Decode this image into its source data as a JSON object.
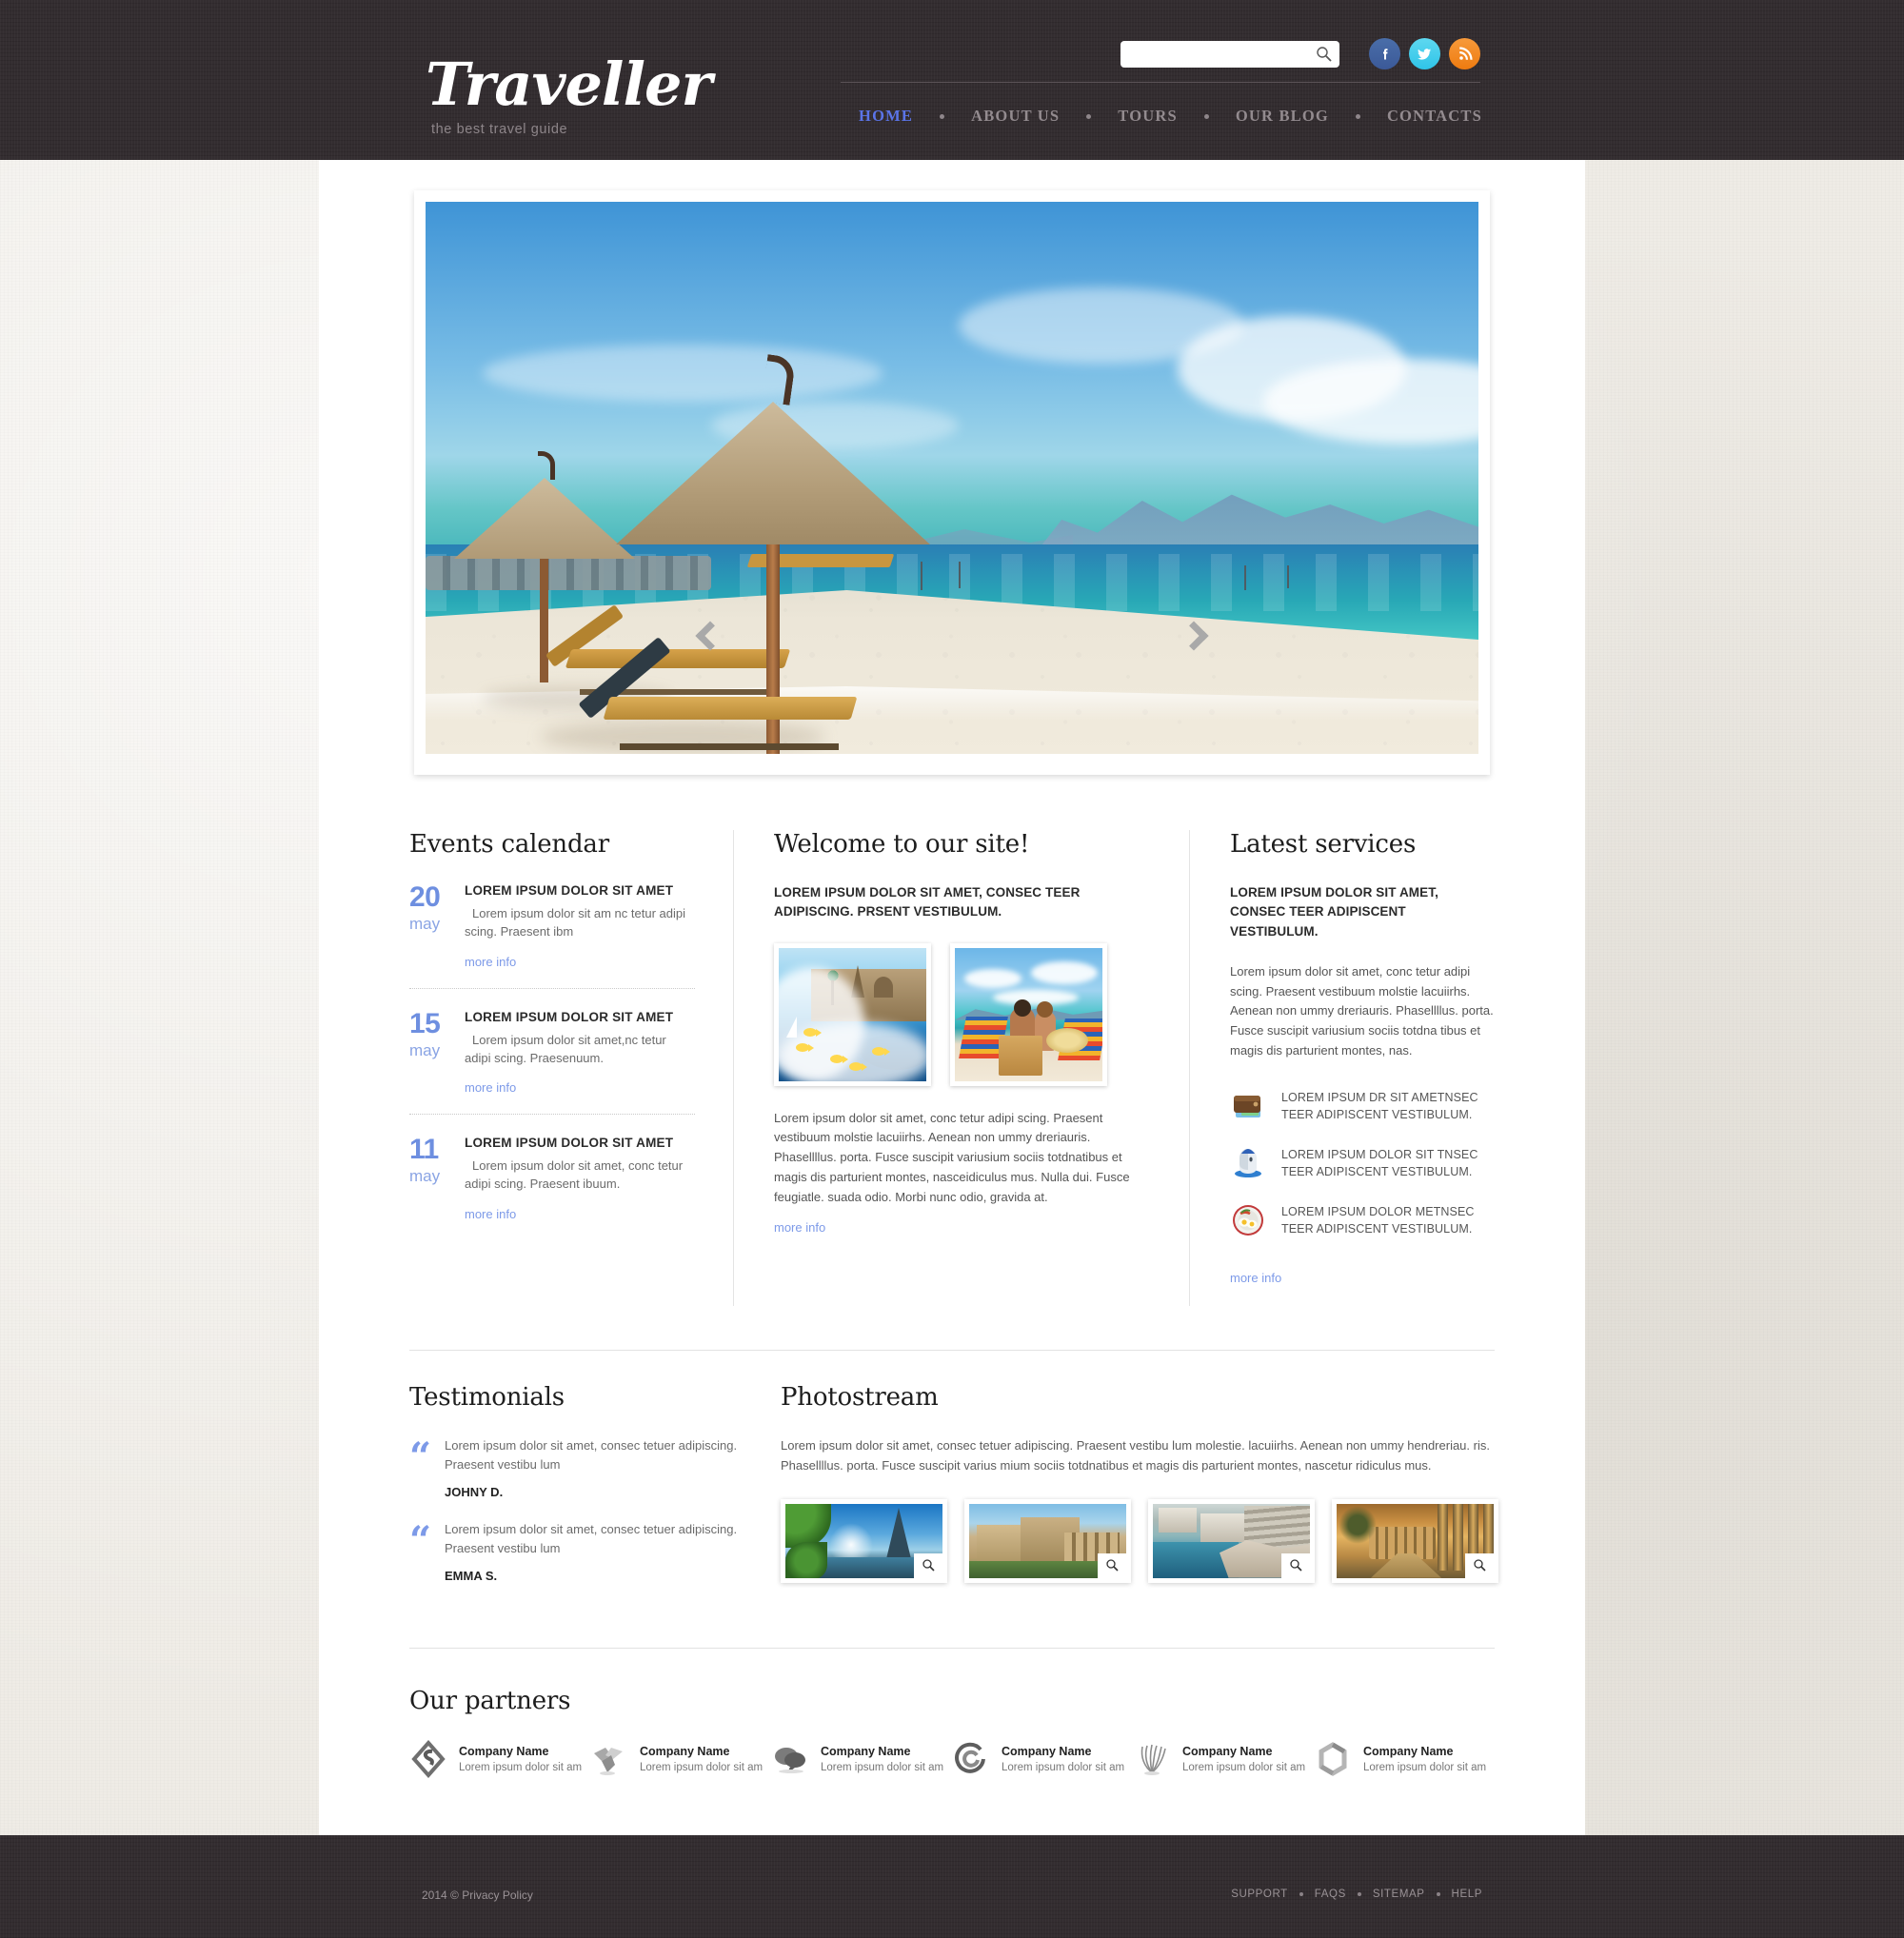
{
  "header": {
    "logo": "Traveller",
    "tagline": "the best travel guide",
    "search": {
      "placeholder": "",
      "value": "",
      "icon": "search-icon"
    },
    "social": [
      {
        "name": "facebook-icon",
        "color": "#3b5998"
      },
      {
        "name": "twitter-icon",
        "color": "#2fc4e8"
      },
      {
        "name": "rss-icon",
        "color": "#ee7b10"
      }
    ],
    "nav": [
      {
        "label": "HOME",
        "active": true
      },
      {
        "label": "ABOUT US",
        "active": false
      },
      {
        "label": "TOURS",
        "active": false
      },
      {
        "label": "OUR BLOG",
        "active": false
      },
      {
        "label": "CONTACTS",
        "active": false
      }
    ]
  },
  "slider": {
    "prev_label": "‹",
    "next_label": "›",
    "image_alt": "beach-with-thatched-parasols"
  },
  "events": {
    "title": "Events calendar",
    "items": [
      {
        "day": "20",
        "month": "may",
        "title": "LOREM IPSUM DOLOR SIT AMET",
        "desc": "Lorem ipsum dolor sit am nc tetur adipi scing. Praesent ibm",
        "more": "more info"
      },
      {
        "day": "15",
        "month": "may",
        "title": "LOREM IPSUM DOLOR SIT AMET",
        "desc": "Lorem ipsum dolor sit amet,nc tetur adipi scing. Praesenuum.",
        "more": "more info"
      },
      {
        "day": "11",
        "month": "may",
        "title": "LOREM IPSUM DOLOR SIT AMET",
        "desc": "Lorem ipsum dolor sit amet, conc tetur adipi scing. Praesent ibuum.",
        "more": "more info"
      }
    ]
  },
  "welcome": {
    "title": "Welcome to our site!",
    "lead": "LOREM IPSUM DOLOR SIT AMET, CONSEC TEER ADIPISCING. PRSENT VESTIBULUM.",
    "images": [
      {
        "name": "travel-collage-image"
      },
      {
        "name": "beach-couple-image"
      }
    ],
    "body": "Lorem ipsum dolor sit amet, conc tetur adipi scing. Praesent vestibuum molstie lacuiirhs. Aenean non ummy dreriauris. Phasellllus. porta. Fusce suscipit variusium sociis totdnatibus et magis dis parturient montes, nasceidiculus mus. Nulla dui. Fusce feugiatle. suada odio. Morbi nunc odio, gravida at.",
    "more": "more info"
  },
  "services": {
    "title": "Latest services",
    "lead": "LOREM IPSUM DOLOR SIT AMET, CONSEC TEER ADIPISCENT VESTIBULUM.",
    "body": "Lorem ipsum dolor sit amet, conc tetur adipi scing. Praesent vestibuum molstie lacuiirhs. Aenean non ummy dreriauris. Phasellllus. porta. Fusce suscipit variusium sociis totdna tibus et magis dis parturient montes, nas.",
    "items": [
      {
        "icon": "wallet-icon",
        "text": "LOREM IPSUM DR SIT AMETNSEC TEER ADIPISCENT VESTIBULUM."
      },
      {
        "icon": "mouse-icon",
        "text": "LOREM IPSUM DOLOR SIT TNSEC TEER ADIPISCENT VESTIBULUM."
      },
      {
        "icon": "breakfast-plate-icon",
        "text": "LOREM IPSUM DOLOR METNSEC TEER ADIPISCENT VESTIBULUM."
      }
    ],
    "more": "more info"
  },
  "testimonials": {
    "title": "Testimonials",
    "items": [
      {
        "quote": "“",
        "text": "Lorem ipsum dolor sit amet, consec tetuer adipiscing. Praesent vestibu lum",
        "author": "JOHNY D."
      },
      {
        "quote": "“",
        "text": "Lorem ipsum dolor sit amet, consec tetuer adipiscing. Praesent vestibu lum",
        "author": "EMMA S."
      }
    ]
  },
  "photostream": {
    "title": "Photostream",
    "intro": "Lorem ipsum dolor sit amet, consec tetuer adipiscing. Praesent vestibu lum molestie. lacuiirhs. Aenean non ummy hendreriau. ris. Phasellllus. porta. Fusce suscipit varius mium sociis totdnatibus et magis dis parturient montes, nascetur ridiculus mus.",
    "items": [
      {
        "name": "eiffel-tower-photo",
        "zoom": "zoom-icon"
      },
      {
        "name": "roman-ruins-photo",
        "zoom": "zoom-icon"
      },
      {
        "name": "coastal-resort-photo",
        "zoom": "zoom-icon"
      },
      {
        "name": "colosseum-photo",
        "zoom": "zoom-icon"
      }
    ]
  },
  "partners": {
    "title": "Our partners",
    "items": [
      {
        "logo": "diamond-s-logo",
        "name": "Company Name",
        "desc": "Lorem ipsum dolor sit am"
      },
      {
        "logo": "folded-ribbon-logo",
        "name": "Company Name",
        "desc": "Lorem ipsum dolor sit am"
      },
      {
        "logo": "speech-bubbles-logo",
        "name": "Company Name",
        "desc": "Lorem ipsum dolor sit am"
      },
      {
        "logo": "circle-spiral-logo",
        "name": "Company Name",
        "desc": "Lorem ipsum dolor sit am"
      },
      {
        "logo": "feather-fan-logo",
        "name": "Company Name",
        "desc": "Lorem ipsum dolor sit am"
      },
      {
        "logo": "hexagon-ring-logo",
        "name": "Company Name",
        "desc": "Lorem ipsum dolor sit am"
      }
    ]
  },
  "footer": {
    "copyright": "2014 © Privacy Policy",
    "links": [
      {
        "label": "SUPPORT"
      },
      {
        "label": "FAQS"
      },
      {
        "label": "SITEMAP"
      },
      {
        "label": "HELP"
      }
    ]
  },
  "colors": {
    "header_bg": "#332d30",
    "accent_blue": "#6e8fe0",
    "link_blue": "#7d9ae8",
    "nav_active": "#5b74e8",
    "page_bg": "#efece6"
  }
}
